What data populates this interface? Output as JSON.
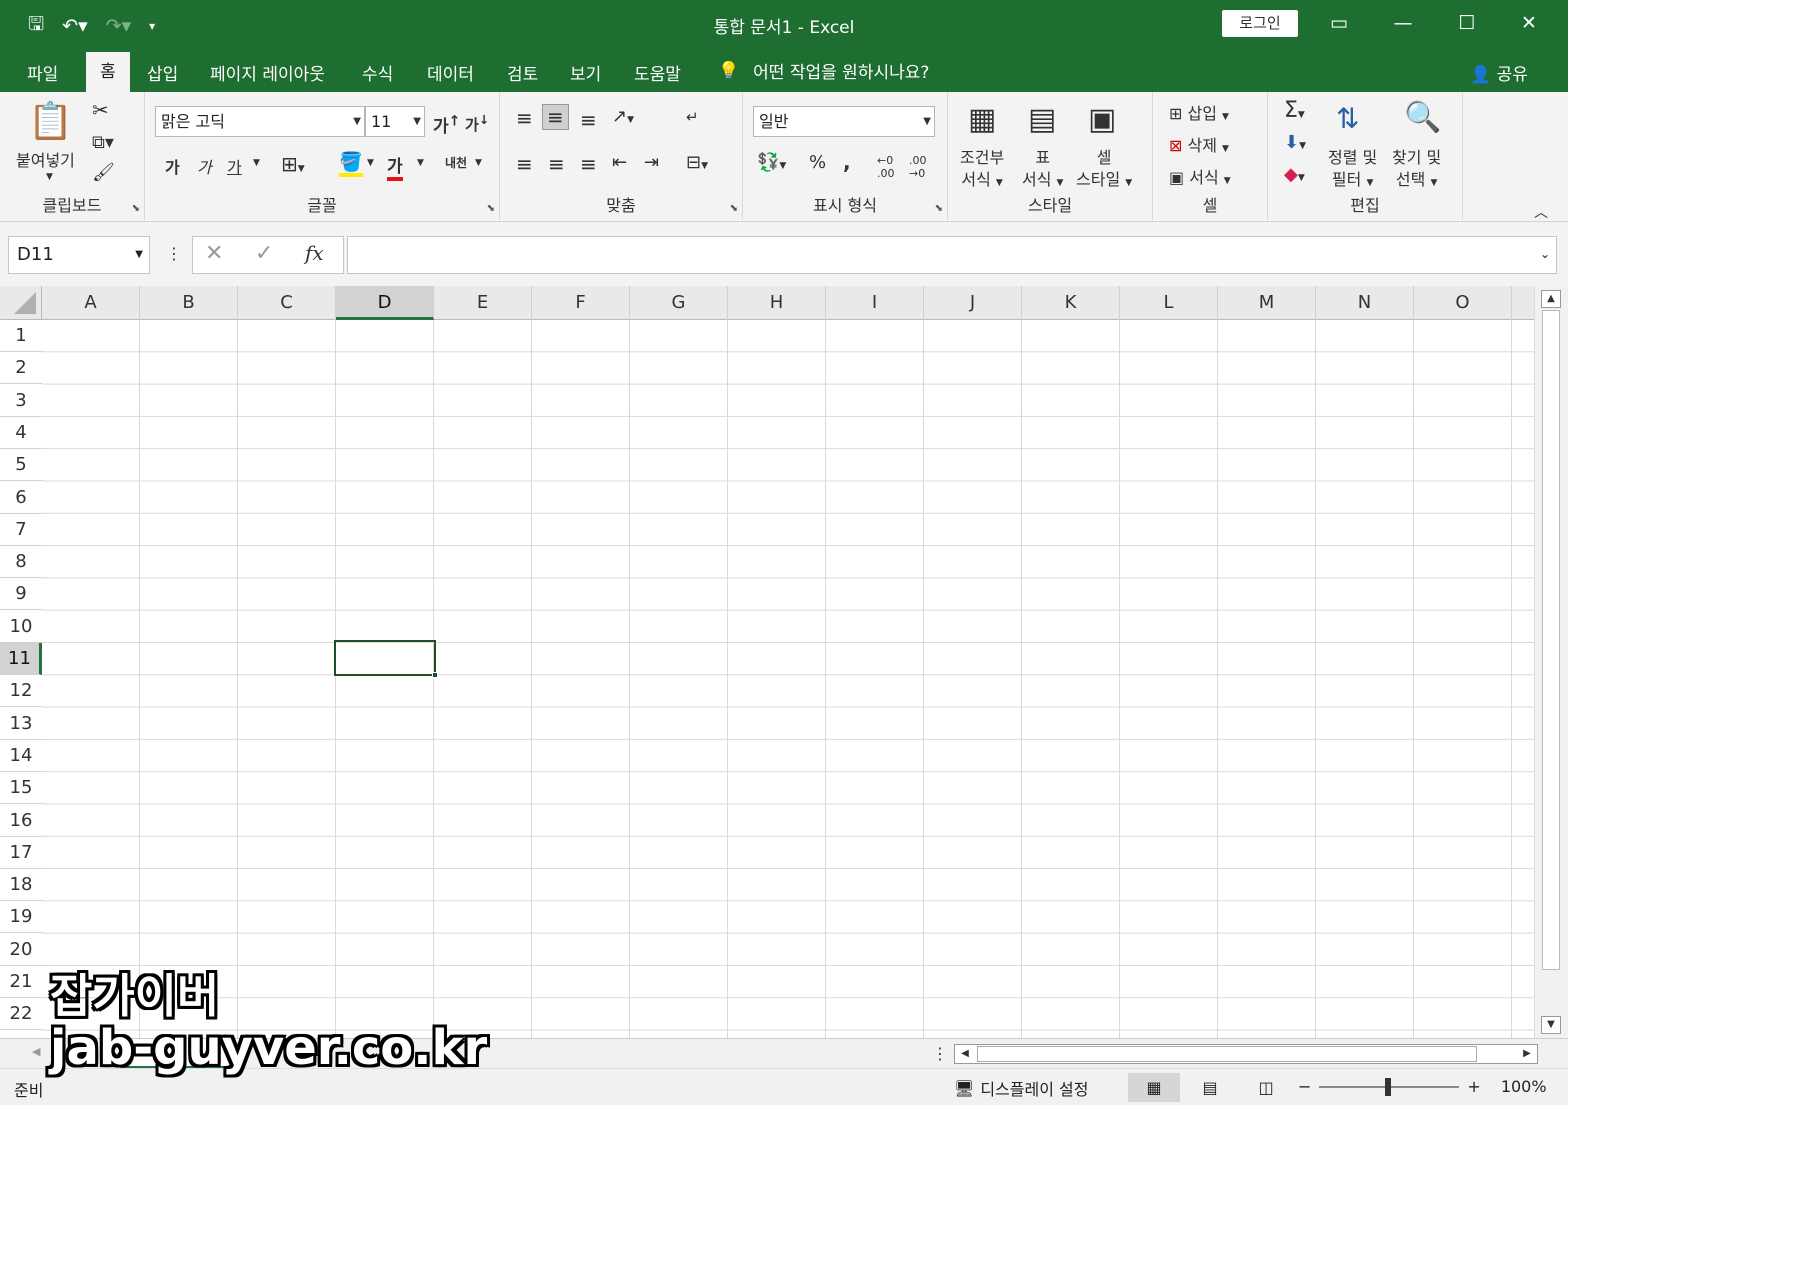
{
  "title_bar": {
    "title": "통합 문서1  -  Excel",
    "login_label": "로그인"
  },
  "menu": {
    "tabs": [
      "파일",
      "홈",
      "삽입",
      "페이지 레이아웃",
      "수식",
      "데이터",
      "검토",
      "보기",
      "도움말"
    ],
    "tell_me": "어떤 작업을 원하시나요?",
    "share": "공유"
  },
  "ribbon": {
    "clipboard": {
      "label": "클립보드",
      "paste": "붙여넣기"
    },
    "font": {
      "label": "글꼴",
      "font_name": "맑은 고딕",
      "font_size": "11",
      "grow": "가",
      "shrink": "가",
      "bold": "가",
      "italic": "가",
      "underline": "가",
      "font_color": "가",
      "phonetic": "내천"
    },
    "alignment": {
      "label": "맞춤"
    },
    "number": {
      "label": "표시 형식",
      "format": "일반",
      "percent": "%",
      "comma": ","
    },
    "styles": {
      "label": "스타일",
      "conditional_line1": "조건부",
      "conditional_line2": "서식",
      "table_line1": "표",
      "table_line2": "서식",
      "cell_line1": "셀",
      "cell_line2": "스타일"
    },
    "cells": {
      "label": "셀",
      "insert": "삽입",
      "delete": "삭제",
      "format": "서식"
    },
    "editing": {
      "label": "편집",
      "sort_line1": "정렬 및",
      "sort_line2": "필터",
      "find_line1": "찾기 및",
      "find_line2": "선택"
    }
  },
  "formula_bar": {
    "name_box": "D11",
    "formula": ""
  },
  "sheet": {
    "columns": [
      "A",
      "B",
      "C",
      "D",
      "E",
      "F",
      "G",
      "H",
      "I",
      "J",
      "K",
      "L",
      "M",
      "N",
      "O"
    ],
    "rows": [
      "1",
      "2",
      "3",
      "4",
      "5",
      "6",
      "7",
      "8",
      "9",
      "10",
      "11",
      "12",
      "13",
      "14",
      "15",
      "16",
      "17",
      "18",
      "19",
      "20",
      "21",
      "22"
    ],
    "active_column": "D",
    "active_row": "11"
  },
  "status_bar": {
    "status": "준비",
    "display_settings": "디스플레이 설정",
    "zoom": "100%"
  },
  "watermark": {
    "line1": "잡가이버",
    "line2": "jab-guyver.co.kr"
  }
}
